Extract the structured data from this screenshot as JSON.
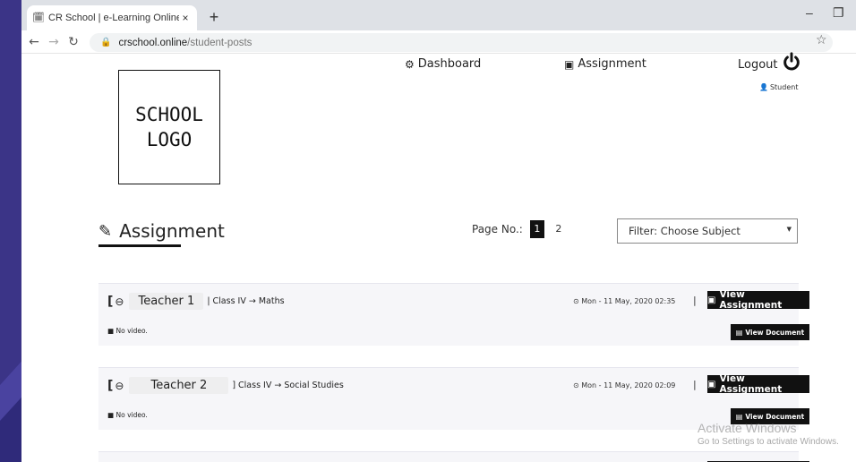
{
  "browser": {
    "tab_title": "CR School | e-Learning Online Sc",
    "tab_close": "×",
    "new_tab": "+",
    "minimize": "–",
    "restore": "❐",
    "url_host": "crschool.online",
    "url_path": "/student-posts"
  },
  "header": {
    "logo_line1": "SCHOOL",
    "logo_line2": "LOGO",
    "nav_dashboard": "Dashboard",
    "nav_assignment": "Assignment",
    "logout": "Logout",
    "role": "Student"
  },
  "main": {
    "section_title": "Assignment",
    "page_label": "Page No.:",
    "pages": [
      "1",
      "2"
    ],
    "active_page": "1",
    "filter_placeholder": "Filter: Choose Subject"
  },
  "posts": [
    {
      "teacher": "Teacher 1",
      "course": "| Class IV → Maths",
      "date": "⊙ Mon - 11 May, 2020 02:35",
      "view_assignment": "View Assignment",
      "video": "No video.",
      "view_document": "View Document"
    },
    {
      "teacher": "Teacher 2",
      "course": "] Class IV → Social Studies",
      "date": "⊙ Mon - 11 May, 2020 02:09",
      "view_assignment": "View Assignment",
      "video": "No video.",
      "view_document": "View Document"
    }
  ],
  "watermark": {
    "line1": "Activate Windows",
    "line2": "Go to Settings to activate Windows."
  },
  "colors": {
    "backdrop": "#2f2a7a",
    "button": "#111111",
    "card_bg": "#f6f6f9"
  }
}
